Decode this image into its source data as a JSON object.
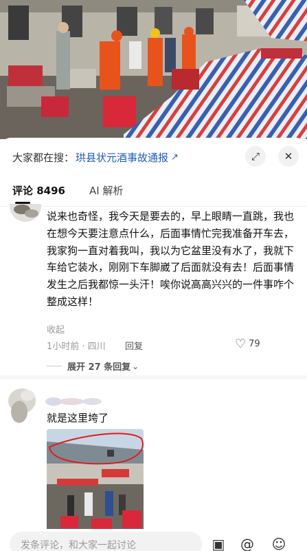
{
  "search": {
    "prefix": "大家都在搜：",
    "query": "珙县状元酒事故通报",
    "arrow": "↗"
  },
  "header_buttons": {
    "expand_icon": "expand-icon",
    "close_icon": "close-icon",
    "expand_glyph": "⤢",
    "close_glyph": "✕"
  },
  "tabs": {
    "comments_label": "评论 8496",
    "ai_label": "AI 解析"
  },
  "comments": [
    {
      "text": "说来也奇怪，我今天是要去的，早上眼睛一直跳，我也在想今天要注意点什么，后面事情忙完我准备开车去，我家狗一直对着我叫，我以为它盆里没有水了，我就下车给它装水，刚刚下车脚崴了后面就没有去！后面事情发生之后我都惊一头汗！唉你说高高兴兴的一件事咋个整成这样！",
      "collapse_label": "收起",
      "time_location": "1小时前 · 四川",
      "reply_label": "回复",
      "likes": "79",
      "expand_replies_label": "展开 27 条回复"
    },
    {
      "text": "就是这里垮了"
    }
  ],
  "input_bar": {
    "placeholder": "发条评论，和大家一起讨论",
    "icons": [
      "image-icon",
      "mention-icon",
      "emoji-icon"
    ],
    "glyphs": [
      "▣",
      "@",
      "☺"
    ]
  },
  "colors": {
    "link_blue": "#1f5bb8",
    "rescue_orange": "#e8531c",
    "tarp_blue": "#3a5fb0",
    "tarp_red": "#d8403a",
    "annotation_red": "#e01c1c"
  }
}
